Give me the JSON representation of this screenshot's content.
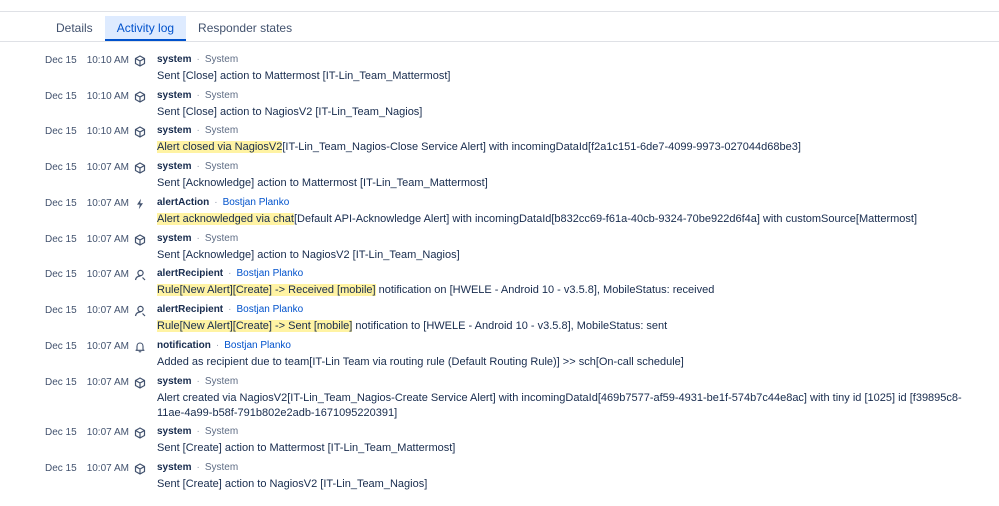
{
  "tabs": [
    {
      "label": "Details",
      "active": false
    },
    {
      "label": "Activity log",
      "active": true
    },
    {
      "label": "Responder states",
      "active": false
    }
  ],
  "colors": {
    "accent": "#0052cc",
    "highlight": "#fff3a3",
    "tab_active_bg": "#deebff"
  },
  "log": [
    {
      "date": "Dec 15",
      "time": "10:10 AM",
      "icon": "cube-icon",
      "actor": "system",
      "who": "System",
      "who_link": false,
      "highlight": "",
      "message": "Sent [Close] action to Mattermost [IT-Lin_Team_Mattermost]"
    },
    {
      "date": "Dec 15",
      "time": "10:10 AM",
      "icon": "cube-icon",
      "actor": "system",
      "who": "System",
      "who_link": false,
      "highlight": "",
      "message": "Sent [Close] action to NagiosV2 [IT-Lin_Team_Nagios]"
    },
    {
      "date": "Dec 15",
      "time": "10:10 AM",
      "icon": "cube-icon",
      "actor": "system",
      "who": "System",
      "who_link": false,
      "highlight": "Alert closed via NagiosV2",
      "message": "[IT-Lin_Team_Nagios-Close Service Alert] with incomingDataId[f2a1c151-6de7-4099-9973-027044d68be3]"
    },
    {
      "date": "Dec 15",
      "time": "10:07 AM",
      "icon": "cube-icon",
      "actor": "system",
      "who": "System",
      "who_link": false,
      "highlight": "",
      "message": "Sent [Acknowledge] action to Mattermost [IT-Lin_Team_Mattermost]"
    },
    {
      "date": "Dec 15",
      "time": "10:07 AM",
      "icon": "lightning-icon",
      "actor": "alertAction",
      "who": "Bostjan Planko",
      "who_link": true,
      "highlight": "Alert acknowledged via chat",
      "message": "[Default API-Acknowledge Alert] with incomingDataId[b832cc69-f61a-40cb-9324-70be922d6f4a] with customSource[Mattermost]"
    },
    {
      "date": "Dec 15",
      "time": "10:07 AM",
      "icon": "cube-icon",
      "actor": "system",
      "who": "System",
      "who_link": false,
      "highlight": "",
      "message": "Sent [Acknowledge] action to NagiosV2 [IT-Lin_Team_Nagios]"
    },
    {
      "date": "Dec 15",
      "time": "10:07 AM",
      "icon": "person-icon",
      "actor": "alertRecipient",
      "who": "Bostjan Planko",
      "who_link": true,
      "highlight": "Rule[New Alert][Create] -> Received [mobile]",
      "message": " notification on [HWELE - Android 10 - v3.5.8], MobileStatus: received"
    },
    {
      "date": "Dec 15",
      "time": "10:07 AM",
      "icon": "person-icon",
      "actor": "alertRecipient",
      "who": "Bostjan Planko",
      "who_link": true,
      "highlight": "Rule[New Alert][Create] -> Sent [mobile]",
      "message": " notification to [HWELE - Android 10 - v3.5.8], MobileStatus: sent"
    },
    {
      "date": "Dec 15",
      "time": "10:07 AM",
      "icon": "bell-icon",
      "actor": "notification",
      "who": "Bostjan Planko",
      "who_link": true,
      "highlight": "",
      "message": "Added as recipient due to team[IT-Lin Team via routing rule (Default Routing Rule)] >> sch[On-call schedule]"
    },
    {
      "date": "Dec 15",
      "time": "10:07 AM",
      "icon": "cube-icon",
      "actor": "system",
      "who": "System",
      "who_link": false,
      "highlight": "",
      "message": "Alert created via NagiosV2[IT-Lin_Team_Nagios-Create Service Alert] with incomingDataId[469b7577-af59-4931-be1f-574b7c44e8ac] with tiny id [1025] id [f39895c8-11ae-4a99-b58f-791b802e2adb-1671095220391]"
    },
    {
      "date": "Dec 15",
      "time": "10:07 AM",
      "icon": "cube-icon",
      "actor": "system",
      "who": "System",
      "who_link": false,
      "highlight": "",
      "message": "Sent [Create] action to Mattermost [IT-Lin_Team_Mattermost]"
    },
    {
      "date": "Dec 15",
      "time": "10:07 AM",
      "icon": "cube-icon",
      "actor": "system",
      "who": "System",
      "who_link": false,
      "highlight": "",
      "message": "Sent [Create] action to NagiosV2 [IT-Lin_Team_Nagios]"
    }
  ]
}
